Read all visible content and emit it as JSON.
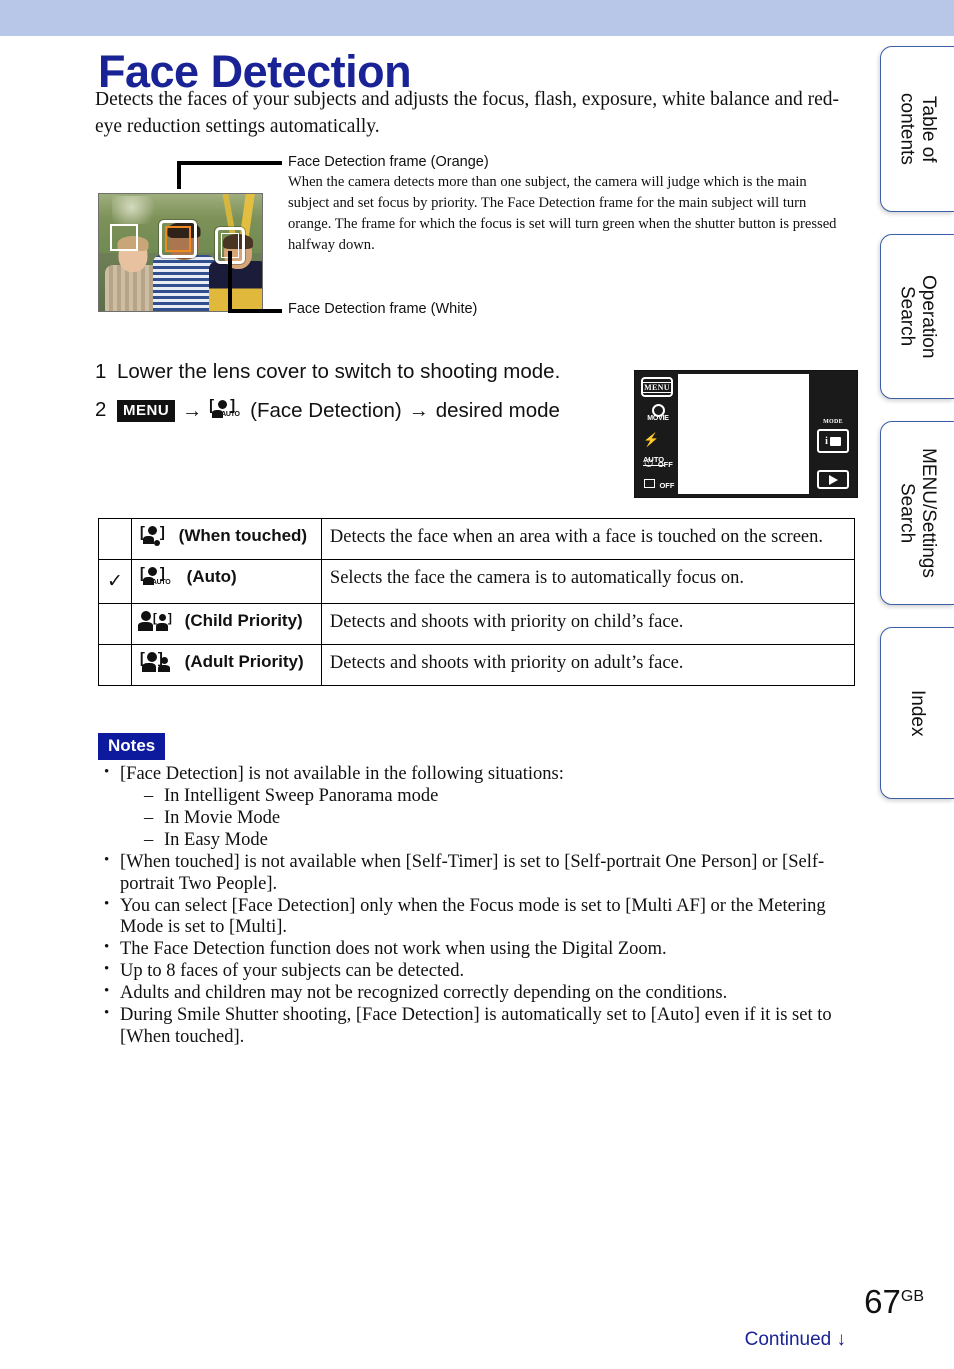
{
  "document": {
    "title": "Face Detection",
    "intro": "Detects the faces of your subjects and adjusts the focus, flash, exposure, white balance and red-eye reduction settings automatically."
  },
  "illustration": {
    "callout_orange_title": "Face Detection frame (Orange)",
    "callout_orange_body": "When the camera detects more than one subject, the camera will judge which is the main subject and set focus by priority. The Face Detection frame for the main subject will turn orange. The frame for which the focus is set will turn green when the shutter button is pressed halfway down.",
    "callout_white_title": "Face Detection frame (White)"
  },
  "steps": [
    {
      "num": "1",
      "text": "Lower the lens cover to switch to shooting mode."
    },
    {
      "num": "2",
      "menu_label": "MENU",
      "arrow1": "→",
      "icon_label": "face-detection-auto-icon",
      "icon_sub": "AUTO",
      "mid_text": "(Face Detection)",
      "arrow2": "→",
      "end_text": "desired mode"
    }
  ],
  "camera_screen": {
    "menu_button": "MENU",
    "movie_label": "MOVIE",
    "flash_label": "AUTO",
    "timer_label": "OFF",
    "burst_label": "OFF",
    "mode_label": "MODE",
    "mode_icon": "intelligent-auto-icon",
    "play_icon": "playback-icon"
  },
  "table": {
    "rows": [
      {
        "checked": "",
        "icon": "face-detection-touch-icon",
        "icon_sub": "",
        "mode": "(When touched)",
        "desc": "Detects the face when an area with a face is touched on the screen."
      },
      {
        "checked": "✓",
        "icon": "face-detection-auto-icon",
        "icon_sub": "AUTO",
        "mode": "(Auto)",
        "desc": "Selects the face the camera is to automatically focus on."
      },
      {
        "checked": "",
        "icon": "face-detection-child-icon",
        "icon_sub": "",
        "mode": "(Child Priority)",
        "desc": "Detects and shoots with priority on child’s face."
      },
      {
        "checked": "",
        "icon": "face-detection-adult-icon",
        "icon_sub": "",
        "mode": "(Adult Priority)",
        "desc": "Detects and shoots with priority on adult’s face."
      }
    ]
  },
  "notes": {
    "label": "Notes",
    "items": [
      {
        "text": "[Face Detection] is not available in the following situations:",
        "sub": [
          "In Intelligent Sweep Panorama mode",
          "In Movie Mode",
          "In Easy Mode"
        ]
      },
      {
        "text": "[When touched] is not available when [Self-Timer] is set to [Self-portrait One Person] or [Self-portrait Two People].",
        "sub": []
      },
      {
        "text": "You can select [Face Detection] only when the Focus mode is set to [Multi AF] or the Metering Mode is set to [Multi].",
        "sub": []
      },
      {
        "text": "The Face Detection function does not work when using the Digital Zoom.",
        "sub": []
      },
      {
        "text": "Up to 8 faces of your subjects can be detected.",
        "sub": []
      },
      {
        "text": "Adults and children may not be recognized correctly depending on the conditions.",
        "sub": []
      },
      {
        "text": "During Smile Shutter shooting, [Face Detection] is automatically set to [Auto] even if it is set to [When touched].",
        "sub": []
      }
    ]
  },
  "sidebar_tabs": [
    {
      "label": "Table of\ncontents"
    },
    {
      "label": "Operation\nSearch"
    },
    {
      "label": "MENU/Settings\nSearch"
    },
    {
      "label": "Index"
    }
  ],
  "footer": {
    "page_number": "67",
    "page_suffix": "GB",
    "continued": "Continued",
    "continued_arrow": "↓"
  },
  "colors": {
    "top_band": "#b8c6e8",
    "title_blue": "#1a2396",
    "notes_badge": "#0d1a9e",
    "tab_border": "#3a5fa8",
    "frame_orange": "#f08a20"
  }
}
